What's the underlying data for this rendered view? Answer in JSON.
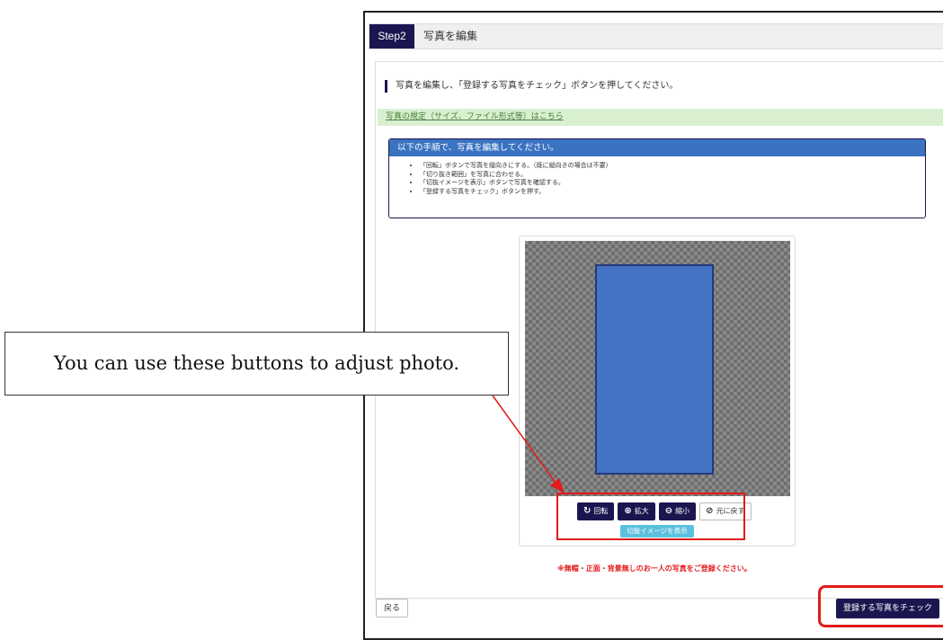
{
  "header": {
    "step_badge": "Step2",
    "title": "写真を編集"
  },
  "instruction": "写真を編集し、「登録する写真をチェック」ボタンを押してください。",
  "spec_link": "写真の規定（サイズ、ファイル形式等）はこちら",
  "steps_panel": {
    "heading": "以下の手順で、写真を編集してください。",
    "items": [
      "「回転」ボタンで写真を縦向きにする。（既に縦向きの場合は不要）",
      "「切り抜き範囲」を写真に合わせる。",
      "「切抜イメージを表示」ボタンで写真を確認する。",
      "「登録する写真をチェック」ボタンを押す。"
    ]
  },
  "toolbar": {
    "rotate": {
      "icon": "rotate-icon",
      "label": "回転"
    },
    "zoom_in": {
      "icon": "zoom-in-icon",
      "label": "拡大"
    },
    "zoom_out": {
      "icon": "zoom-out-icon",
      "label": "縮小"
    },
    "reset": {
      "icon": "reset-icon",
      "label": "元に戻す"
    }
  },
  "preview_button": "切抜イメージを表示",
  "notice": "※無帽・正面・背景無しのお一人の写真をご登録ください。",
  "back_button": "戻る",
  "check_button": "登録する写真をチェック",
  "callout": "You can use these buttons to adjust photo.",
  "colors": {
    "brand": "#1c1650",
    "accent_blue": "#3a73c2",
    "highlight_red": "#e31a1a",
    "crop": "#4472c4"
  }
}
